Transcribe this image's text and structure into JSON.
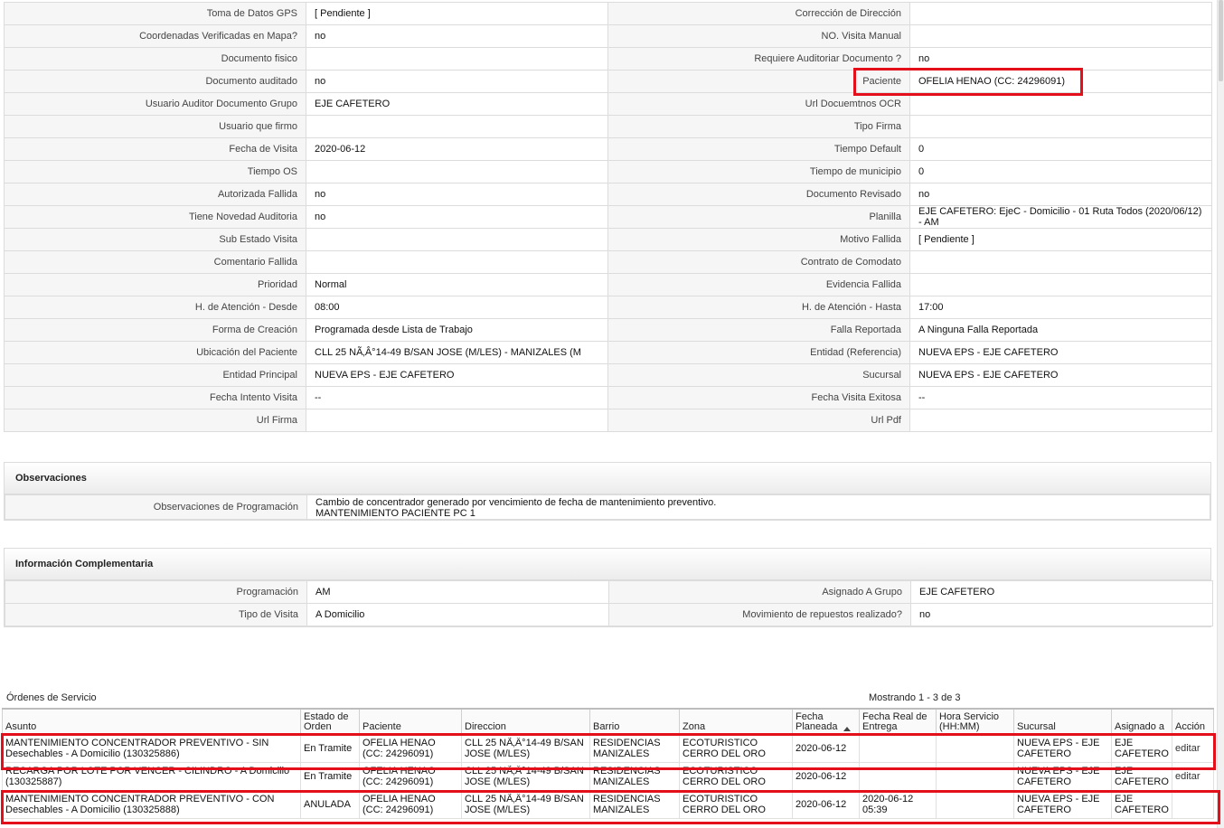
{
  "detail_rows": [
    {
      "l1": "Toma de Datos GPS",
      "v1": "[ Pendiente ]",
      "l2": "Corrección de Dirección",
      "v2": ""
    },
    {
      "l1": "Coordenadas Verificadas en Mapa?",
      "v1": " no",
      "l2": "NO. Visita Manual",
      "v2": ""
    },
    {
      "l1": "Documento fisico",
      "v1": "",
      "l2": "Requiere Auditoriar Documento ?",
      "v2": " no"
    },
    {
      "l1": "Documento auditado",
      "v1": " no",
      "l2": "Paciente",
      "v2": "OFELIA HENAO (CC: 24296091)"
    },
    {
      "l1": "Usuario Auditor Documento Grupo",
      "v1": "EJE CAFETERO",
      "l2": "Url Docuemtnos OCR",
      "v2": ""
    },
    {
      "l1": "Usuario que firmo",
      "v1": "",
      "l2": "Tipo Firma",
      "v2": ""
    },
    {
      "l1": "Fecha de Visita",
      "v1": " 2020-06-12",
      "l2": "Tiempo Default",
      "v2": "0"
    },
    {
      "l1": "Tiempo OS",
      "v1": "",
      "l2": "Tiempo de municipio",
      "v2": "0"
    },
    {
      "l1": "Autorizada Fallida",
      "v1": " no",
      "l2": "Documento Revisado",
      "v2": " no"
    },
    {
      "l1": "Tiene Novedad Auditoria",
      "v1": " no",
      "l2": "Planilla",
      "v2": "EJE CAFETERO: EjeC - Domicilio - 01 Ruta Todos (2020/06/12) - AM"
    },
    {
      "l1": "Sub Estado Visita",
      "v1": "",
      "l2": "Motivo Fallida",
      "v2": "[ Pendiente ]"
    },
    {
      "l1": "Comentario Fallida",
      "v1": "",
      "l2": "Contrato de Comodato",
      "v2": ""
    },
    {
      "l1": "Prioridad",
      "v1": "Normal",
      "l2": "Evidencia Fallida",
      "v2": ""
    },
    {
      "l1": "H. de Atención - Desde",
      "v1": "08:00",
      "l2": "H. de Atención - Hasta",
      "v2": "17:00"
    },
    {
      "l1": "Forma de Creación",
      "v1": "Programada desde Lista de Trabajo",
      "l2": "Falla Reportada",
      "v2": "A Ninguna Falla Reportada"
    },
    {
      "l1": "Ubicación del Paciente",
      "v1": "CLL 25 NÃ‚Â°14-49 B/SAN JOSE (M/LES) - MANIZALES (M",
      "l2": "Entidad (Referencia)",
      "v2": "NUEVA EPS - EJE CAFETERO"
    },
    {
      "l1": "Entidad Principal",
      "v1": "NUEVA EPS - EJE CAFETERO",
      "l2": "Sucursal",
      "v2": "NUEVA EPS - EJE CAFETERO"
    },
    {
      "l1": "Fecha Intento Visita",
      "v1": " --",
      "l2": "Fecha Visita Exitosa",
      "v2": " --"
    },
    {
      "l1": "Url Firma",
      "v1": "",
      "l2": "Url Pdf",
      "v2": ""
    }
  ],
  "observaciones": {
    "title": "Observaciones",
    "label": "Observaciones de Programación",
    "value": "  Cambio de concentrador generado por vencimiento de fecha de mantenimiento preventivo.\nMANTENIMIENTO PACIENTE PC 1"
  },
  "complementaria": {
    "title": "Información Complementaria",
    "rows": [
      {
        "l1": "Programación",
        "v1": "AM",
        "l2": "Asignado A Grupo",
        "v2": "EJE CAFETERO"
      },
      {
        "l1": "Tipo de Visita",
        "v1": "A Domicilio",
        "l2": "Movimiento de repuestos realizado?",
        "v2": " no"
      }
    ]
  },
  "orders": {
    "title": "Órdenes de Servicio",
    "count": "Mostrando 1 - 3 de 3",
    "headers": [
      "Asunto",
      "Estado de Orden",
      "Paciente",
      "Direccion",
      "Barrio",
      "Zona",
      "Fecha Planeada",
      "Fecha Real de Entrega",
      "Hora Servicio (HH:MM)",
      "Sucursal",
      "Asignado a",
      "Acción"
    ],
    "rows": [
      {
        "asunto": "MANTENIMIENTO CONCENTRADOR PREVENTIVO - SIN Desechables - A Domicilio (130325886)",
        "estado": "En Tramite",
        "paciente": "OFELIA HENAO (CC: 24296091)",
        "direccion": "CLL 25 NÃ‚Â°14-49 B/SAN JOSE (M/LES)",
        "barrio": "RESIDENCIAS MANIZALES",
        "zona": "ECOTURISTICO CERRO DEL ORO",
        "fecha_planeada": "2020-06-12",
        "fecha_real": "",
        "hora": "",
        "sucursal": "NUEVA EPS - EJE CAFETERO",
        "asignado": "EJE CAFETERO",
        "accion": "editar"
      },
      {
        "asunto": "RECARGA POR LOTE POR VENCER - CILINDRO - A Domicilio (130325887)",
        "estado": "En Tramite",
        "paciente": "OFELIA HENAO (CC: 24296091)",
        "direccion": "CLL 25 NÃ‚Â°14-49 B/SAN JOSE (M/LES)",
        "barrio": "RESIDENCIAS MANIZALES",
        "zona": "ECOTURISTICO CERRO DEL ORO",
        "fecha_planeada": "2020-06-12",
        "fecha_real": "",
        "hora": "",
        "sucursal": "NUEVA EPS - EJE CAFETERO",
        "asignado": "EJE CAFETERO",
        "accion": "editar"
      },
      {
        "asunto": "MANTENIMIENTO CONCENTRADOR PREVENTIVO - CON Desechables - A Domicilio (130325888)",
        "estado": "ANULADA",
        "paciente": "OFELIA HENAO (CC: 24296091)",
        "direccion": "CLL 25 NÃ‚Â°14-49 B/SAN JOSE (M/LES)",
        "barrio": "RESIDENCIAS MANIZALES",
        "zona": "ECOTURISTICO CERRO DEL ORO",
        "fecha_planeada": "2020-06-12",
        "fecha_real": "2020-06-12 05:39",
        "hora": "",
        "sucursal": "NUEVA EPS - EJE CAFETERO",
        "asignado": "EJE CAFETERO",
        "accion": ""
      }
    ]
  },
  "colors": {
    "highlight": "#e3101b",
    "label_bg": "#f6f6f6",
    "border": "#dcdcdc"
  }
}
